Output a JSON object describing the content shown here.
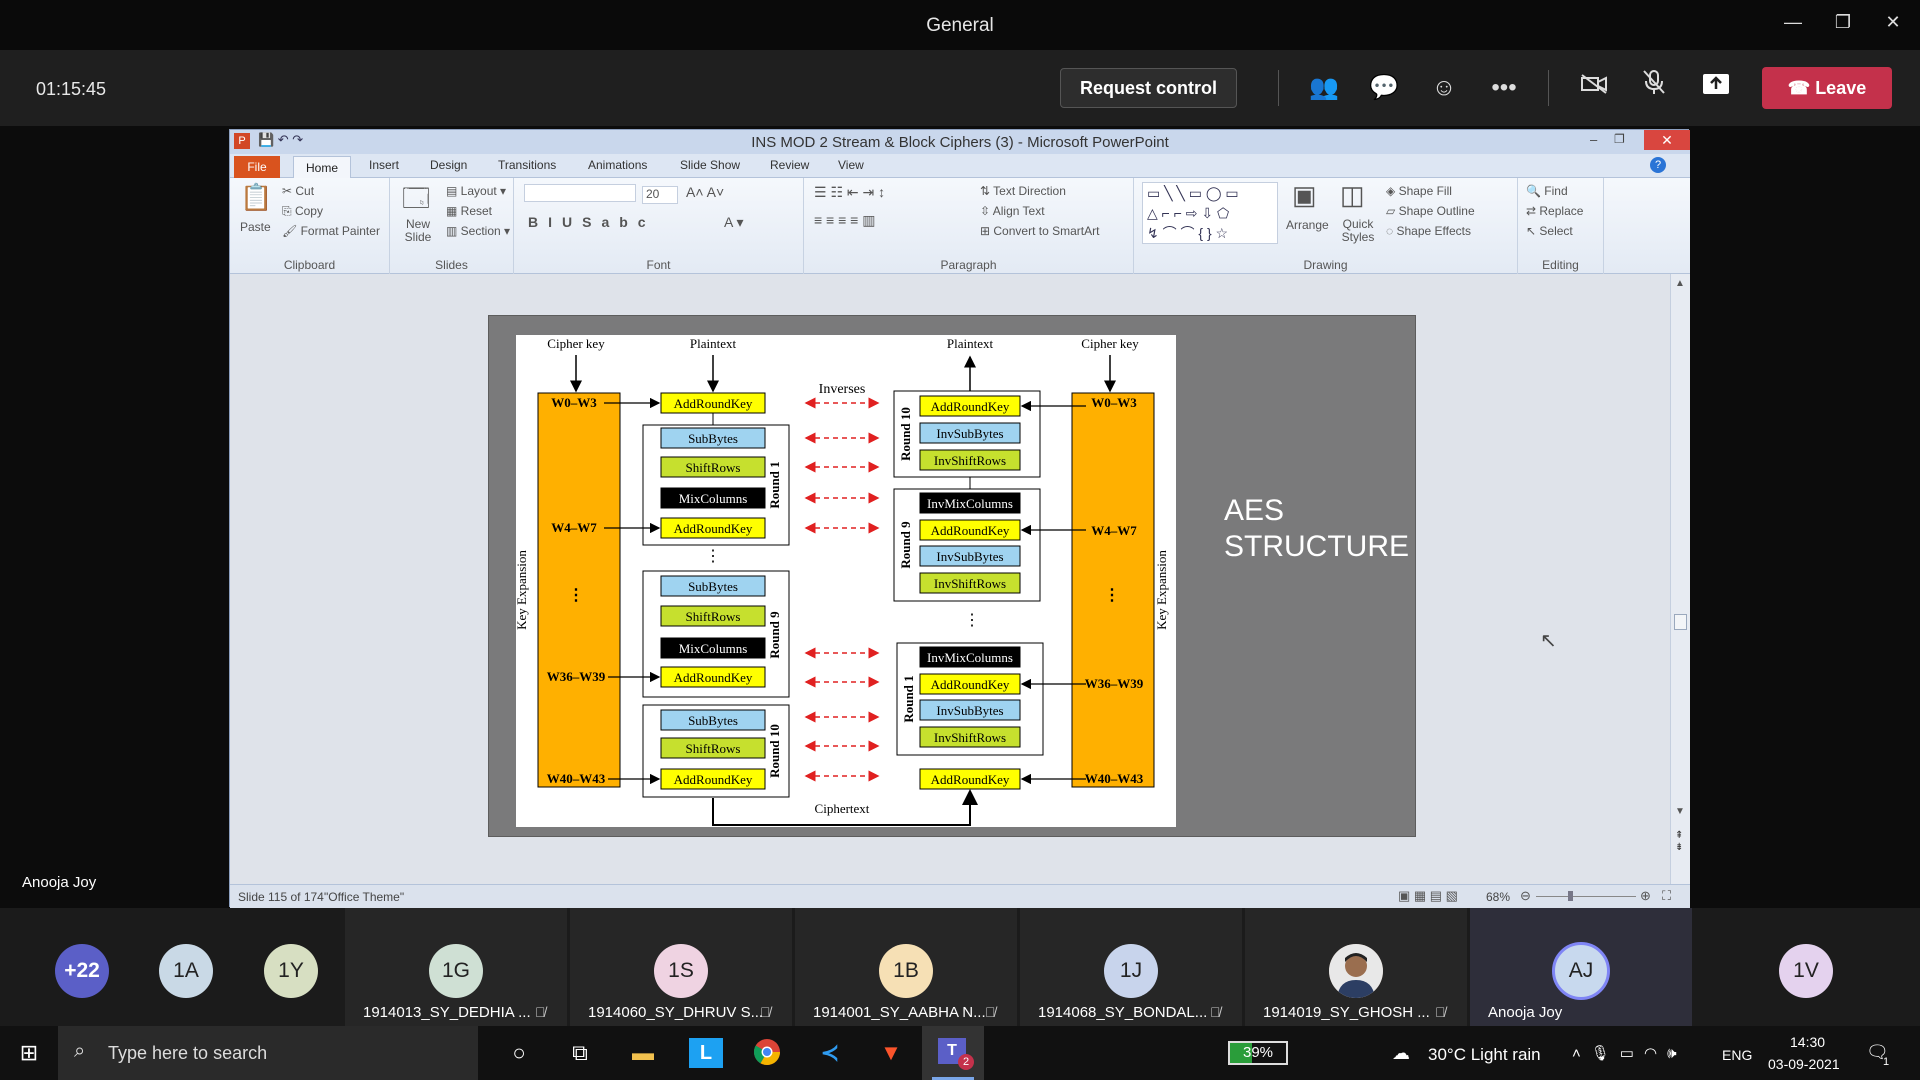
{
  "window": {
    "title": "General"
  },
  "call": {
    "timer": "01:15:45",
    "request_control": "Request control",
    "leave": "Leave"
  },
  "ppt": {
    "title": "INS MOD 2 Stream & Block Ciphers (3)  -  Microsoft PowerPoint",
    "tabs": [
      "File",
      "Home",
      "Insert",
      "Design",
      "Transitions",
      "Animations",
      "Slide Show",
      "Review",
      "View"
    ],
    "clipboard": {
      "paste": "Paste",
      "cut": "Cut",
      "copy": "Copy",
      "format_painter": "Format Painter",
      "label": "Clipboard"
    },
    "slides": {
      "new_slide": "New Slide",
      "layout": "Layout",
      "reset": "Reset",
      "section": "Section",
      "label": "Slides"
    },
    "font": {
      "size": "20",
      "label": "Font"
    },
    "paragraph": {
      "text_direction": "Text Direction",
      "align_text": "Align Text",
      "convert": "Convert to SmartArt",
      "label": "Paragraph"
    },
    "drawing": {
      "arrange": "Arrange",
      "quick_styles": "Quick Styles",
      "shape_fill": "Shape Fill",
      "shape_outline": "Shape Outline",
      "shape_effects": "Shape Effects",
      "label": "Drawing"
    },
    "editing": {
      "find": "Find",
      "replace": "Replace",
      "select": "Select",
      "label": "Editing"
    },
    "status": {
      "slide": "Slide 115 of 174",
      "theme": "\"Office Theme\"",
      "zoom": "68%"
    }
  },
  "slide": {
    "title_line1": "AES",
    "title_line2": "STRUCTURE",
    "diagram": {
      "cipher_key": "Cipher key",
      "plaintext": "Plaintext",
      "ciphertext": "Ciphertext",
      "inverses": "Inverses",
      "key_expansion": "Key Expansion",
      "w0": "W0–W3",
      "w4": "W4–W7",
      "w36": "W36–W39",
      "w40": "W40–W43",
      "add_round_key": "AddRoundKey",
      "sub_bytes": "SubBytes",
      "shift_rows": "ShiftRows",
      "mix_columns": "MixColumns",
      "inv_sub_bytes": "InvSubBytes",
      "inv_shift_rows": "InvShiftRows",
      "inv_mix_columns": "InvMixColumns",
      "round1": "Round 1",
      "round9": "Round 9",
      "round10": "Round 10"
    }
  },
  "presenter": "Anooja Joy",
  "participants": [
    {
      "initials": "+22"
    },
    {
      "initials": "1A"
    },
    {
      "initials": "1Y"
    },
    {
      "initials": "1G",
      "name": "1914013_SY_DEDHIA ..."
    },
    {
      "initials": "1S",
      "name": "1914060_SY_DHRUV S..."
    },
    {
      "initials": "1B",
      "name": "1914001_SY_AABHA N..."
    },
    {
      "initials": "1J",
      "name": "1914068_SY_BONDAL..."
    },
    {
      "initials": "",
      "name": "1914019_SY_GHOSH ..."
    },
    {
      "initials": "AJ",
      "name": "Anooja Joy"
    },
    {
      "initials": "1V"
    }
  ],
  "taskbar": {
    "search_placeholder": "Type here to search",
    "battery": "39%",
    "weather": "30°C  Light rain",
    "lang": "ENG",
    "time": "14:30",
    "date": "03-09-2021",
    "teams_badge": "2",
    "notif_count": "1"
  },
  "colors": {
    "accent_red": "#c4314b",
    "key_orange": "#ffb000",
    "yellow": "#ffff00",
    "blue": "#9fd3f0",
    "green": "#c6e02e"
  }
}
